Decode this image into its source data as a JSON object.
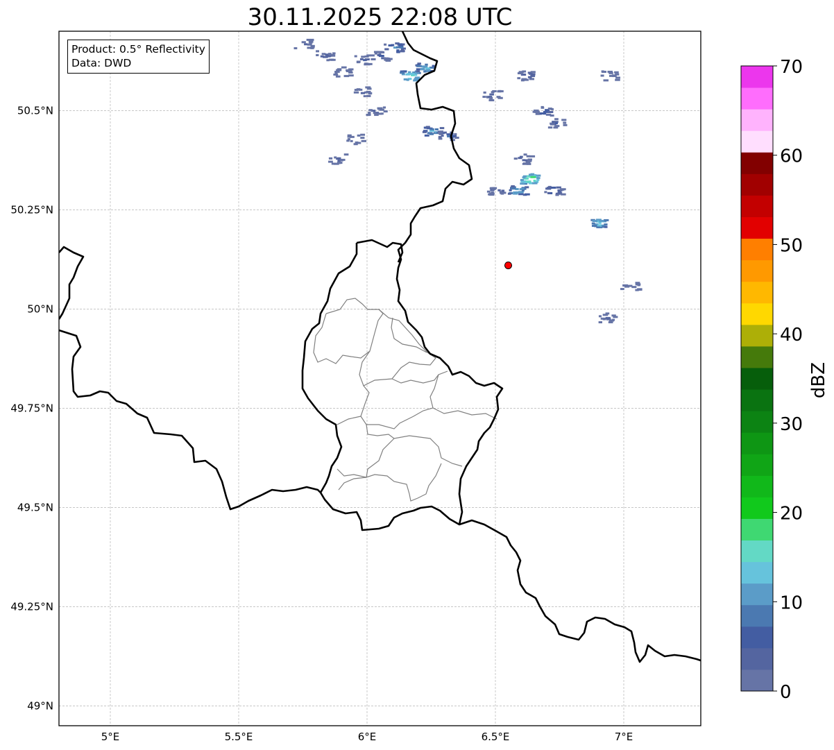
{
  "title": "30.11.2025 22:08 UTC",
  "info": {
    "product": "Product: 0.5° Reflectivity",
    "source": "Data: DWD"
  },
  "map": {
    "projection": "PlateCarree",
    "extent_lon": [
      4.8,
      7.3
    ],
    "extent_lat": [
      48.95,
      50.7
    ],
    "lon_ticks": [
      {
        "value": 5.0,
        "label": "5°E"
      },
      {
        "value": 5.5,
        "label": "5.5°E"
      },
      {
        "value": 6.0,
        "label": "6°E"
      },
      {
        "value": 6.5,
        "label": "6.5°E"
      },
      {
        "value": 7.0,
        "label": "7°E"
      }
    ],
    "lat_ticks": [
      {
        "value": 50.5,
        "label": "50.5°N"
      },
      {
        "value": 50.25,
        "label": "50.25°N"
      },
      {
        "value": 50.0,
        "label": "50°N"
      },
      {
        "value": 49.75,
        "label": "49.75°N"
      },
      {
        "value": 49.5,
        "label": "49.5°N"
      },
      {
        "value": 49.25,
        "label": "49.25°N"
      },
      {
        "value": 49.0,
        "label": "49°N"
      }
    ],
    "gridlines": true,
    "radar_site": {
      "lon": 6.55,
      "lat": 50.11,
      "color": "#ff0000"
    }
  },
  "colorbar": {
    "label": "dBZ",
    "min": 0,
    "max": 70,
    "step": 2.5,
    "tick_labels": [
      "0",
      "10",
      "20",
      "30",
      "40",
      "50",
      "60",
      "70"
    ],
    "colors": [
      "#6674a6",
      "#5465a0",
      "#435da2",
      "#4b79b1",
      "#5b9cc8",
      "#66c3dc",
      "#63d9c5",
      "#3fd872",
      "#11c91c",
      "#11b81a",
      "#10a516",
      "#0e9614",
      "#0c8313",
      "#0a7311",
      "#065e0b",
      "#457a0b",
      "#adaf07",
      "#ffd800",
      "#ffb800",
      "#ff9900",
      "#ff7f00",
      "#e20000",
      "#c30000",
      "#a10000",
      "#820000",
      "#ffdefe",
      "#ffb3fd",
      "#ff6dfd",
      "#ec36ed"
    ]
  },
  "echo_cells": [
    {
      "lon": 5.75,
      "lat": 50.67,
      "dbz": 4
    },
    {
      "lon": 5.83,
      "lat": 50.64,
      "dbz": 6
    },
    {
      "lon": 5.9,
      "lat": 50.6,
      "dbz": 5
    },
    {
      "lon": 5.98,
      "lat": 50.63,
      "dbz": 7
    },
    {
      "lon": 6.05,
      "lat": 50.64,
      "dbz": 6
    },
    {
      "lon": 6.1,
      "lat": 50.66,
      "dbz": 12
    },
    {
      "lon": 6.16,
      "lat": 50.59,
      "dbz": 18
    },
    {
      "lon": 6.22,
      "lat": 50.61,
      "dbz": 14
    },
    {
      "lon": 5.98,
      "lat": 50.55,
      "dbz": 5
    },
    {
      "lon": 6.03,
      "lat": 50.5,
      "dbz": 6
    },
    {
      "lon": 5.95,
      "lat": 50.43,
      "dbz": 4
    },
    {
      "lon": 5.88,
      "lat": 50.38,
      "dbz": 4
    },
    {
      "lon": 6.25,
      "lat": 50.45,
      "dbz": 14
    },
    {
      "lon": 6.31,
      "lat": 50.44,
      "dbz": 9
    },
    {
      "lon": 6.48,
      "lat": 50.54,
      "dbz": 6
    },
    {
      "lon": 6.62,
      "lat": 50.59,
      "dbz": 7
    },
    {
      "lon": 6.68,
      "lat": 50.5,
      "dbz": 8
    },
    {
      "lon": 6.73,
      "lat": 50.47,
      "dbz": 6
    },
    {
      "lon": 6.6,
      "lat": 50.38,
      "dbz": 8
    },
    {
      "lon": 6.63,
      "lat": 50.33,
      "dbz": 20
    },
    {
      "lon": 6.58,
      "lat": 50.3,
      "dbz": 14
    },
    {
      "lon": 6.5,
      "lat": 50.3,
      "dbz": 7
    },
    {
      "lon": 6.72,
      "lat": 50.3,
      "dbz": 10
    },
    {
      "lon": 6.9,
      "lat": 50.22,
      "dbz": 16
    },
    {
      "lon": 6.94,
      "lat": 50.59,
      "dbz": 4
    },
    {
      "lon": 7.02,
      "lat": 50.06,
      "dbz": 4
    },
    {
      "lon": 6.93,
      "lat": 49.98,
      "dbz": 4
    }
  ]
}
